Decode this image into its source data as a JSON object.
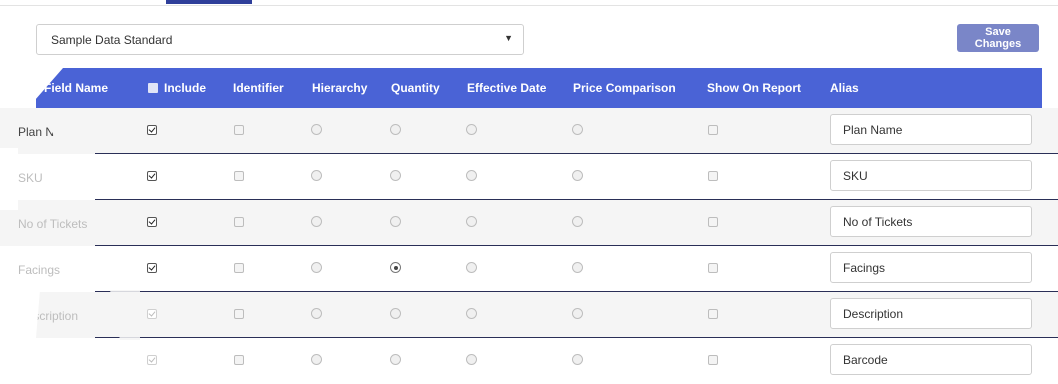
{
  "dataset_select": {
    "value": "Sample Data Standard"
  },
  "save_button": {
    "label": "Save Changes"
  },
  "columns": {
    "field_name": "Field Name",
    "include": "Include",
    "identifier": "Identifier",
    "hierarchy": "Hierarchy",
    "quantity": "Quantity",
    "effective_date": "Effective Date",
    "price_comparison": "Price Comparison",
    "show_on_report": "Show On Report",
    "alias": "Alias"
  },
  "rows": [
    {
      "field": "Plan Name",
      "include": true,
      "include_disabled": false,
      "identifier": false,
      "hierarchy": false,
      "quantity": false,
      "effective_date": false,
      "price_comparison": false,
      "show_on_report": false,
      "alias": "Plan Name"
    },
    {
      "field": "SKU",
      "include": true,
      "include_disabled": false,
      "identifier": false,
      "hierarchy": false,
      "quantity": false,
      "effective_date": false,
      "price_comparison": false,
      "show_on_report": false,
      "alias": "SKU"
    },
    {
      "field": "No of Tickets",
      "include": true,
      "include_disabled": false,
      "identifier": false,
      "hierarchy": false,
      "quantity": false,
      "effective_date": false,
      "price_comparison": false,
      "show_on_report": false,
      "alias": "No of Tickets"
    },
    {
      "field": "Facings",
      "include": true,
      "include_disabled": false,
      "identifier": false,
      "hierarchy": false,
      "quantity": true,
      "effective_date": false,
      "price_comparison": false,
      "show_on_report": false,
      "alias": "Facings"
    },
    {
      "field": "Description",
      "include": true,
      "include_disabled": true,
      "identifier": false,
      "hierarchy": false,
      "quantity": false,
      "effective_date": false,
      "price_comparison": false,
      "show_on_report": false,
      "alias": "Description"
    },
    {
      "field": "",
      "include": true,
      "include_disabled": true,
      "identifier": false,
      "hierarchy": false,
      "quantity": false,
      "effective_date": false,
      "price_comparison": false,
      "show_on_report": false,
      "alias": "Barcode"
    }
  ],
  "colors": {
    "header_bg": "#4a63d6",
    "save_button_bg": "#7a86c8",
    "active_tab": "#2f3f9a"
  },
  "icons": {
    "dropdown_caret": "▼"
  }
}
